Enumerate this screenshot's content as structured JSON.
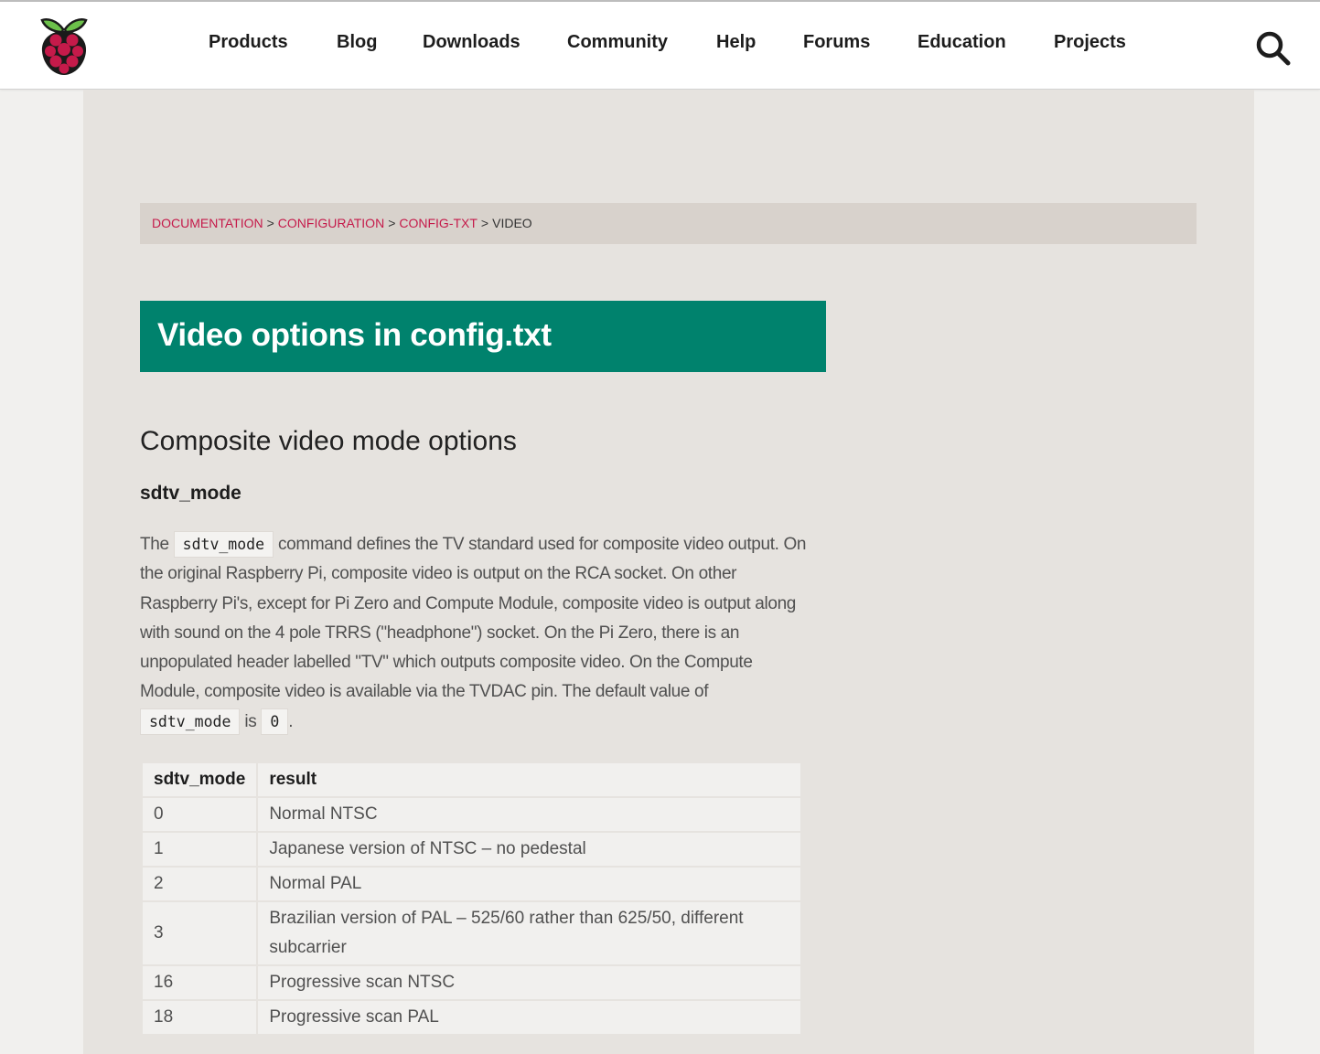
{
  "header": {
    "logo": "raspberry-pi-logo",
    "nav": [
      "Products",
      "Blog",
      "Downloads",
      "Community",
      "Help",
      "Forums",
      "Education",
      "Projects"
    ],
    "search_icon": "search-icon"
  },
  "breadcrumb": {
    "items": [
      "DOCUMENTATION",
      "CONFIGURATION",
      "CONFIG-TXT"
    ],
    "separator": ">",
    "current": "VIDEO"
  },
  "page": {
    "title": "Video options in config.txt",
    "section_title": "Composite video mode options",
    "option_name": "sdtv_mode",
    "description": {
      "part1": "The",
      "code1": "sdtv_mode",
      "part2": "command defines the TV standard used for composite video output. On the original Raspberry Pi, composite video is output on the RCA socket. On other Raspberry Pi's, except for Pi Zero and Compute Module, composite video is output along with sound on the 4 pole TRRS (\"headphone\") socket. On the Pi Zero, there is an unpopulated header labelled \"TV\" which outputs composite video. On the Compute Module, composite video is available via the TVDAC pin. The default value of",
      "code2": "sdtv_mode",
      "part3": "is",
      "code3": "0",
      "part4": "."
    },
    "table": {
      "headers": [
        "sdtv_mode",
        "result"
      ],
      "rows": [
        [
          "0",
          "Normal NTSC"
        ],
        [
          "1",
          "Japanese version of NTSC – no pedestal"
        ],
        [
          "2",
          "Normal PAL"
        ],
        [
          "3",
          "Brazilian version of PAL – 525/60 rather than 625/50, different subcarrier"
        ],
        [
          "16",
          "Progressive scan NTSC"
        ],
        [
          "18",
          "Progressive scan PAL"
        ]
      ]
    }
  },
  "colors": {
    "accent": "#c51a4a",
    "title_bg": "#00826d",
    "content_bg": "#e6e3df",
    "breadcrumb_bg": "#d8d2cc"
  }
}
